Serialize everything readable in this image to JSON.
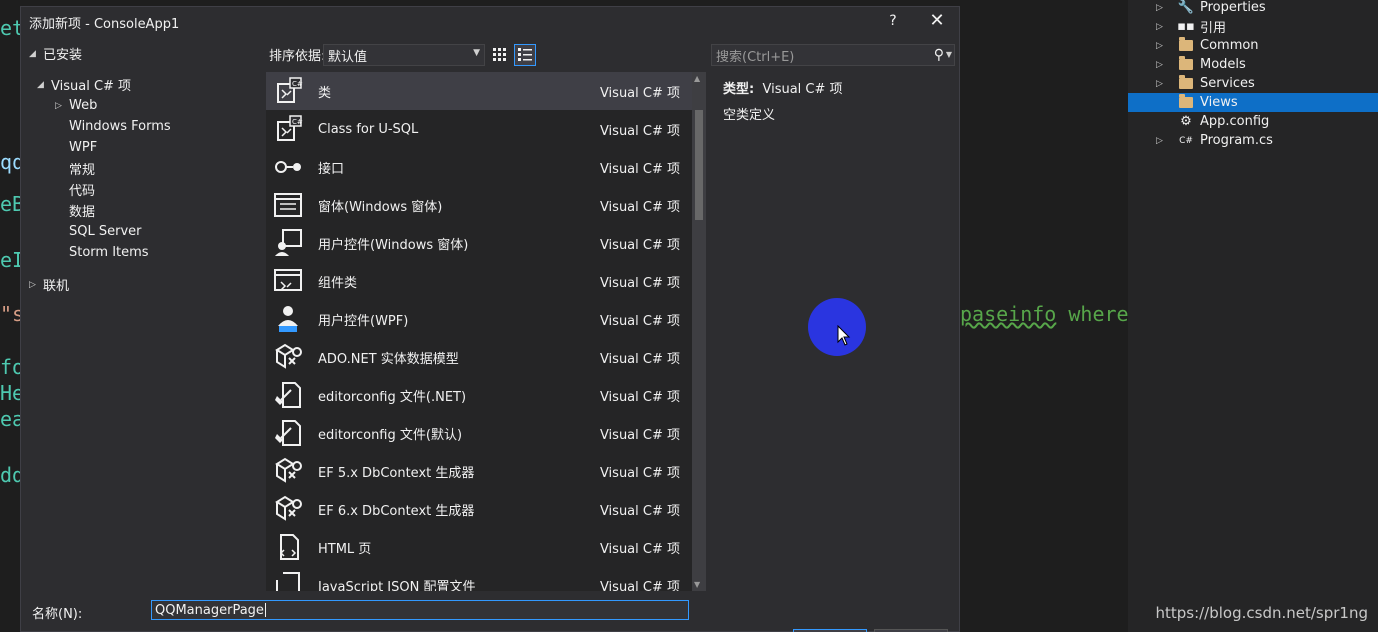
{
  "editor": {
    "lines": [
      {
        "text": "et",
        "kind": "green"
      },
      {
        "text": "qq",
        "kind": "plain"
      },
      {
        "text": "eB",
        "kind": "green"
      },
      {
        "text": "eI",
        "kind": "green"
      },
      {
        "text": "\"s",
        "kind": "str"
      },
      {
        "text": "fo",
        "kind": "green"
      },
      {
        "text": "He",
        "kind": "green"
      },
      {
        "text": "ea",
        "kind": "green"
      },
      {
        "text": "dd",
        "kind": "green"
      }
    ],
    "right_code": {
      "text1": "paseinfo",
      "text2": " where"
    }
  },
  "solution": {
    "items": [
      {
        "label": "Properties",
        "icon": "wrench-icon",
        "expandable": true
      },
      {
        "label": "引用",
        "icon": "references-icon",
        "expandable": true
      },
      {
        "label": "Common",
        "icon": "folder-icon",
        "expandable": true
      },
      {
        "label": "Models",
        "icon": "folder-icon",
        "expandable": true
      },
      {
        "label": "Services",
        "icon": "folder-icon",
        "expandable": true
      },
      {
        "label": "Views",
        "icon": "folder-icon",
        "expandable": false,
        "selected": true
      },
      {
        "label": "App.config",
        "icon": "config-file-icon",
        "expandable": false
      },
      {
        "label": "Program.cs",
        "icon": "csharp-file-icon",
        "expandable": true
      }
    ]
  },
  "watermark": "https://blog.csdn.net/spr1ng",
  "dialog": {
    "title": "添加新项 - ConsoleApp1",
    "help": "?",
    "close": "✕",
    "tree": {
      "installed": "已安装",
      "csharp": "Visual C# 项",
      "children": [
        "Web",
        "Windows Forms",
        "WPF",
        "常规",
        "代码",
        "数据",
        "SQL Server",
        "Storm Items"
      ],
      "online": "联机"
    },
    "sort_label": "排序依据:",
    "sort_value": "默认值",
    "search_placeholder": "搜索(Ctrl+E)",
    "items": [
      {
        "name": "类",
        "lang": "Visual C# 项",
        "icon": "class-icon",
        "selected": true
      },
      {
        "name": "Class for U-SQL",
        "lang": "Visual C# 项",
        "icon": "class-icon"
      },
      {
        "name": "接口",
        "lang": "Visual C# 项",
        "icon": "interface-icon"
      },
      {
        "name": "窗体(Windows 窗体)",
        "lang": "Visual C# 项",
        "icon": "form-icon"
      },
      {
        "name": "用户控件(Windows 窗体)",
        "lang": "Visual C# 项",
        "icon": "user-control-icon"
      },
      {
        "name": "组件类",
        "lang": "Visual C# 项",
        "icon": "component-icon"
      },
      {
        "name": "用户控件(WPF)",
        "lang": "Visual C# 项",
        "icon": "wpf-user-control-icon"
      },
      {
        "name": "ADO.NET 实体数据模型",
        "lang": "Visual C# 项",
        "icon": "entity-model-icon"
      },
      {
        "name": "editorconfig 文件(.NET)",
        "lang": "Visual C# 项",
        "icon": "editorconfig-icon"
      },
      {
        "name": "editorconfig 文件(默认)",
        "lang": "Visual C# 项",
        "icon": "editorconfig-icon"
      },
      {
        "name": "EF 5.x DbContext 生成器",
        "lang": "Visual C# 项",
        "icon": "dbcontext-icon"
      },
      {
        "name": "EF 6.x DbContext 生成器",
        "lang": "Visual C# 项",
        "icon": "dbcontext-icon"
      },
      {
        "name": "HTML 页",
        "lang": "Visual C# 项",
        "icon": "html-page-icon"
      },
      {
        "name": "JavaScript JSON 配置文件",
        "lang": "Visual C# 项",
        "icon": "json-config-icon"
      }
    ],
    "info": {
      "type_label": "类型:",
      "type_value": "Visual C# 项",
      "description": "空类定义"
    },
    "name_label": "名称(N):",
    "name_value": "QQManagerPage"
  }
}
